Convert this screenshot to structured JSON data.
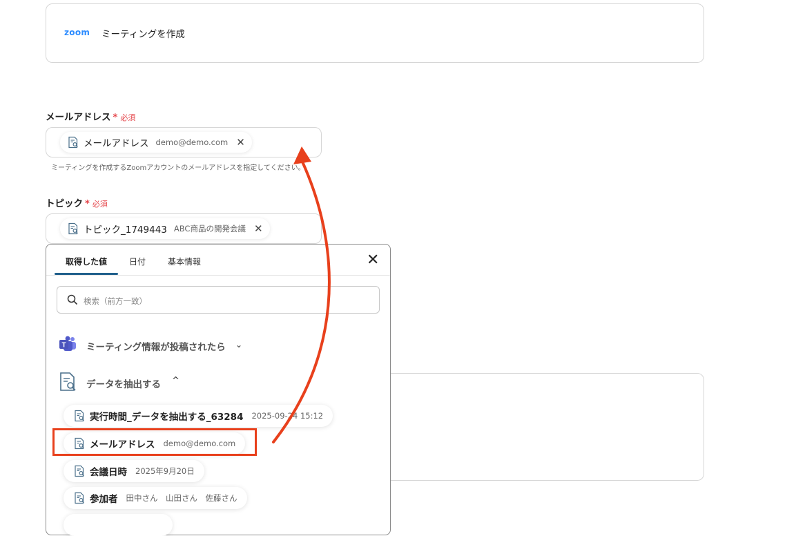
{
  "action": {
    "app_logo": "zoom",
    "title": "ミーティングを作成"
  },
  "fields": {
    "email": {
      "label": "メールアドレス",
      "required_star": "*",
      "required": "必須",
      "chip_name": "メールアドレス",
      "chip_value": "demo@demo.com",
      "help": "ミーティングを作成するZoomアカウントのメールアドレスを指定してください。"
    },
    "topic": {
      "label": "トピック",
      "required_star": "*",
      "required": "必須",
      "chip_name": "トピック_1749443",
      "chip_value": "ABC商品の開発会議"
    }
  },
  "panel": {
    "tabs": [
      "取得した値",
      "日付",
      "基本情報"
    ],
    "active_tab": "取得した値",
    "search_placeholder": "検索（前方一致）",
    "groups": [
      {
        "title": "ミーティング情報が投稿されたら",
        "icon": "teams-icon",
        "expanded": false
      },
      {
        "title": "データを抽出する",
        "icon": "document-search-icon",
        "expanded": true
      }
    ],
    "items": [
      {
        "name": "実行時間_データを抽出する_63284",
        "value": "2025-09-24 15:12"
      },
      {
        "name": "メールアドレス",
        "value": "demo@demo.com",
        "highlighted": true
      },
      {
        "name": "会議日時",
        "value": "2025年9月20日"
      },
      {
        "name": "参加者",
        "value": "田中さん　山田さん　佐藤さん"
      }
    ]
  },
  "colors": {
    "accent_arrow": "#e8401c",
    "tab_underline": "#1f5f8b",
    "required": "#e5484d",
    "zoom_blue": "#2d8cff"
  }
}
